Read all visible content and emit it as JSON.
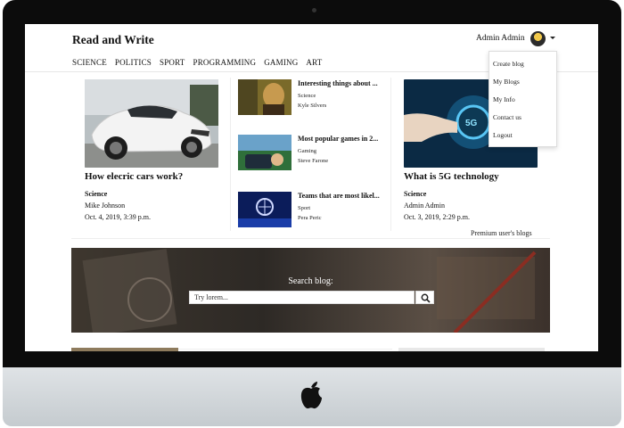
{
  "site": {
    "brand": "Read and Write",
    "user": "Admin Admin"
  },
  "nav": [
    "SCIENCE",
    "POLITICS",
    "SPORT",
    "PROGRAMMING",
    "GAMING",
    "ART"
  ],
  "menu": [
    "Create blog",
    "My Blogs",
    "My Info",
    "Contact us",
    "Logout"
  ],
  "featured": [
    {
      "title": "How elecric cars work?",
      "category": "Science",
      "author": "Mike Johnson",
      "date": "Oct. 4, 2019, 3:39 p.m."
    },
    {
      "title": "What is 5G technology",
      "category": "Science",
      "author": "Admin Admin",
      "date": "Oct. 3, 2019, 2:29 p.m."
    }
  ],
  "mini": [
    {
      "title": "Interesting things about ...",
      "category": "Science",
      "author": "Kyle Silvers"
    },
    {
      "title": "Most popular games in 2...",
      "category": "Gaming",
      "author": "Steve Farone"
    },
    {
      "title": "Teams that are most likel...",
      "category": "Sport",
      "author": "Pera Peric"
    }
  ],
  "premium": "Premium user's blogs",
  "search": {
    "label": "Search blog:",
    "placeholder": "Try lorem..."
  }
}
